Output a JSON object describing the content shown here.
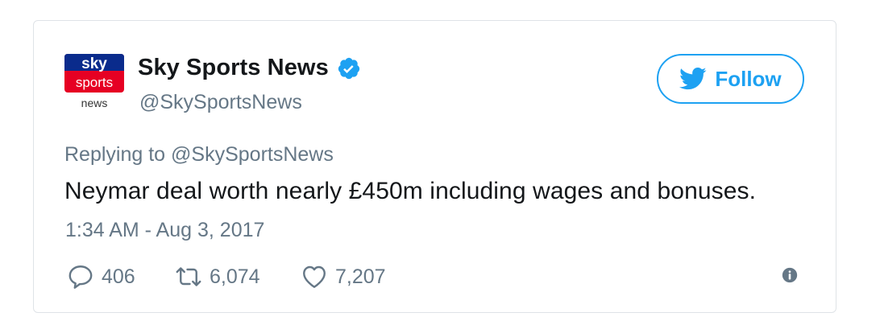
{
  "account": {
    "display_name": "Sky Sports News",
    "handle": "@SkySportsNews",
    "avatar_lines": [
      "sky",
      "sports",
      "news"
    ]
  },
  "follow_label": "Follow",
  "reply": {
    "prefix": "Replying to",
    "mention": "@SkySportsNews"
  },
  "tweet_text": "Neymar deal worth nearly £450m including wages and bonuses.",
  "timestamp": "1:34 AM - Aug 3, 2017",
  "stats": {
    "replies": "406",
    "retweets": "6,074",
    "likes": "7,207"
  },
  "colors": {
    "twitter_blue": "#1da1f2",
    "sky_red": "#e60023",
    "text_dark": "#14171a",
    "text_gray": "#657786"
  },
  "icons": [
    "verified-badge-icon",
    "twitter-bird-icon",
    "reply-icon",
    "retweet-icon",
    "heart-icon",
    "info-icon"
  ]
}
